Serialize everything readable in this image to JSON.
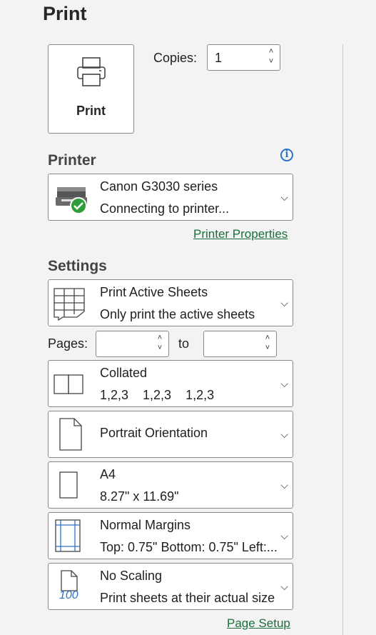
{
  "title": "Print",
  "print_button": {
    "label": "Print",
    "icon": "printer-icon"
  },
  "copies": {
    "label": "Copies:",
    "value": "1"
  },
  "printer": {
    "section": "Printer",
    "name": "Canon G3030 series",
    "status": "Connecting to printer...",
    "properties_link": "Printer Properties"
  },
  "settings": {
    "section": "Settings",
    "sheets": {
      "title": "Print Active Sheets",
      "desc": "Only print the active sheets"
    },
    "pages": {
      "label": "Pages:",
      "to": "to",
      "from_value": "",
      "to_value": ""
    },
    "collation": {
      "title": "Collated",
      "desc": "1,2,3    1,2,3    1,2,3"
    },
    "orientation": {
      "title": "Portrait Orientation"
    },
    "paper": {
      "title": "A4",
      "desc": "8.27\" x 11.69\""
    },
    "margins": {
      "title": "Normal Margins",
      "desc": "Top: 0.75\" Bottom: 0.75\" Left:..."
    },
    "scaling": {
      "title": "No Scaling",
      "desc": "Print sheets at their actual size",
      "icon_text": "100"
    },
    "page_setup_link": "Page Setup"
  },
  "colors": {
    "link": "#1b6e3c",
    "info": "#2b72c8",
    "check": "#2e9d3a"
  }
}
